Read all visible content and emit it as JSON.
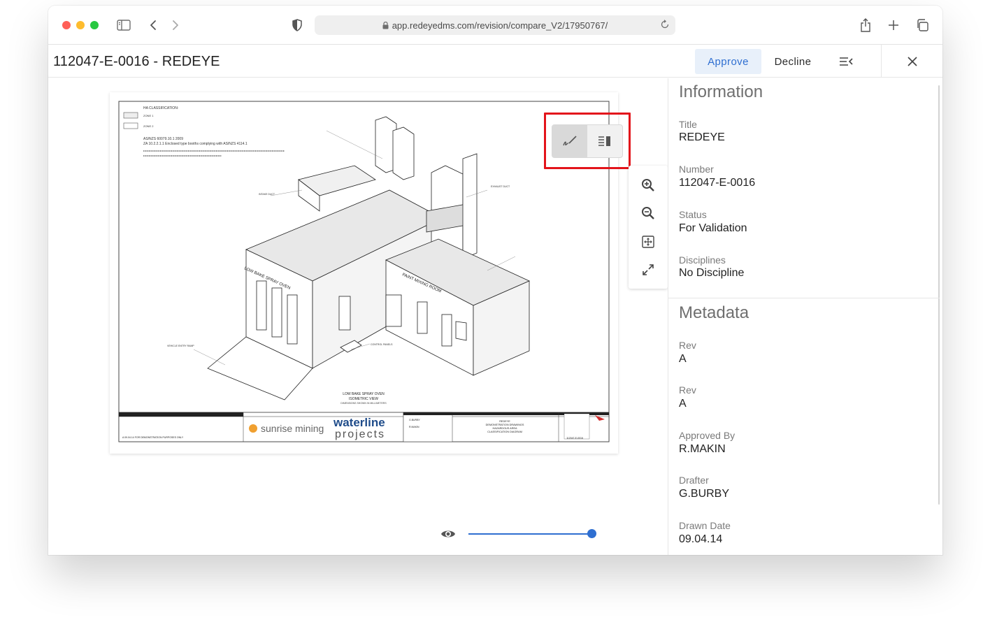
{
  "browser": {
    "url": "app.redeyedms.com/revision/compare_V2/17950767/"
  },
  "header": {
    "title": "112047-E-0016 - REDEYE",
    "approve_label": "Approve",
    "decline_label": "Decline"
  },
  "drawing": {
    "ha_heading": "HA CLASSIFICATION:",
    "zone1": "ZONE 1",
    "zone2": "ZONE 2",
    "std1": "AS/NZS 60079.10.1 2009",
    "std2": "ZA 10.2.2.1.1 Enclosed type booths complying with AS/NZS 4114.1",
    "oven_label": "LOW BAKE SPRAY OVEN",
    "room_label": "PAINT MIXING ROOM",
    "intake_duct": "INTAKE DUCT",
    "exhaust_duct": "EXHAUST DUCT",
    "ramp_label": "VEHICLE ENTRY RAMP",
    "control_panels": "CONTROL PANELS",
    "caption1": "LOW BAKE SPRAY OVEN",
    "caption2": "ISOMETRIC VIEW",
    "caption3": "DIMENSIONS SHOWN IN MILLIMETERS",
    "client_logo": "sunrise mining",
    "company_logo_line1": "waterline",
    "company_logo_line2": "projects",
    "drawing_title_1": "REDEYE",
    "drawing_title_2": "DEMONSTRATION DRAWINGS",
    "drawing_title_3": "HAZARDOUS AREA",
    "drawing_title_4": "CLASSIFICATION DIAGRAM",
    "drawing_no": "112047-E-0016",
    "rev_row": "A  09.04.14  FOR DEMONSTRATION PURPOSES ONLY",
    "drawn": "G.BURBY",
    "approved": "R.MAKIN"
  },
  "info": {
    "section_title": "Information",
    "fields": [
      {
        "label": "Title",
        "value": "REDEYE"
      },
      {
        "label": "Number",
        "value": "112047-E-0016"
      },
      {
        "label": "Status",
        "value": "For Validation"
      },
      {
        "label": "Disciplines",
        "value": "No Discipline"
      }
    ]
  },
  "metadata": {
    "section_title": "Metadata",
    "fields": [
      {
        "label": "Rev",
        "value": "A"
      },
      {
        "label": "Rev",
        "value": "A"
      },
      {
        "label": "Approved By",
        "value": "R.MAKIN"
      },
      {
        "label": "Drafter",
        "value": "G.BURBY"
      },
      {
        "label": "Drawn Date",
        "value": "09.04.14"
      }
    ]
  },
  "viewer": {
    "opacity_slider_percent": 100
  },
  "colors": {
    "accent": "#2f6fd1",
    "highlight": "#e3141b"
  }
}
